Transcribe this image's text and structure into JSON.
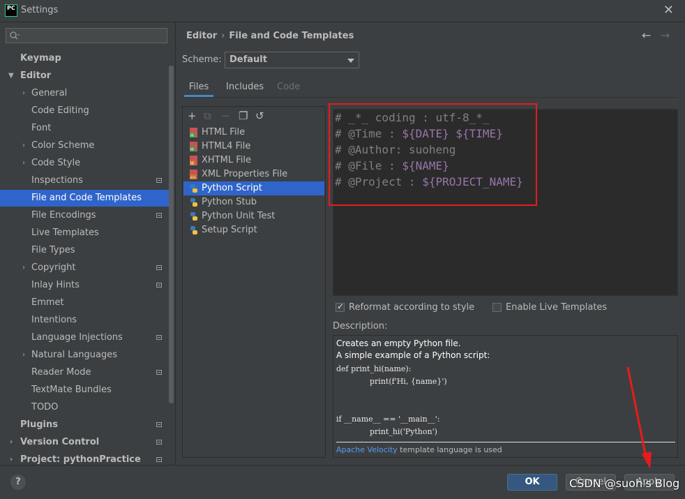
{
  "window": {
    "title": "Settings",
    "app_badge": "PC"
  },
  "sidebar": {
    "search_placeholder": "",
    "items": [
      {
        "label": "Keymap"
      },
      {
        "label": "Editor"
      },
      {
        "label": "General"
      },
      {
        "label": "Code Editing"
      },
      {
        "label": "Font"
      },
      {
        "label": "Color Scheme"
      },
      {
        "label": "Code Style"
      },
      {
        "label": "Inspections"
      },
      {
        "label": "File and Code Templates"
      },
      {
        "label": "File Encodings"
      },
      {
        "label": "Live Templates"
      },
      {
        "label": "File Types"
      },
      {
        "label": "Copyright"
      },
      {
        "label": "Inlay Hints"
      },
      {
        "label": "Emmet"
      },
      {
        "label": "Intentions"
      },
      {
        "label": "Language Injections"
      },
      {
        "label": "Natural Languages"
      },
      {
        "label": "Reader Mode"
      },
      {
        "label": "TextMate Bundles"
      },
      {
        "label": "TODO"
      },
      {
        "label": "Plugins"
      },
      {
        "label": "Version Control"
      },
      {
        "label": "Project: pythonPractice"
      }
    ]
  },
  "breadcrumb": {
    "parent": "Editor",
    "separator": "›",
    "current": "File and Code Templates"
  },
  "scheme": {
    "label": "Scheme:",
    "value": "Default"
  },
  "tabs": [
    {
      "label": "Files"
    },
    {
      "label": "Includes"
    },
    {
      "label": "Code"
    }
  ],
  "templates": [
    {
      "label": "HTML File"
    },
    {
      "label": "HTML4 File"
    },
    {
      "label": "XHTML File"
    },
    {
      "label": "XML Properties File"
    },
    {
      "label": "Python Script"
    },
    {
      "label": "Python Stub"
    },
    {
      "label": "Python Unit Test"
    },
    {
      "label": "Setup Script"
    }
  ],
  "editor": {
    "lines": [
      {
        "prefix": "# _*_ coding : utf-8_*_",
        "var": ""
      },
      {
        "prefix": "# @Time : ",
        "var": "${DATE} ${TIME}"
      },
      {
        "prefix": "# @Author: suoheng",
        "var": ""
      },
      {
        "prefix": "# @File : ",
        "var": "${NAME}"
      },
      {
        "prefix": "# @Project : ",
        "var": "${PROJECT_NAME}"
      }
    ]
  },
  "options": {
    "reformat_label": "Reformat according to style",
    "reformat_checked": true,
    "live_templates_label": "Enable Live Templates",
    "live_templates_checked": false
  },
  "description": {
    "label": "Description:",
    "text_line1": "Creates an empty Python file.",
    "text_line2": "A simple example of a Python script:",
    "code_line1": "def print_hi(name):",
    "code_line2": "print(f'Hi, {name}')",
    "code_line3": "if __name__ == '__main__':",
    "code_line4": "print_hi('Python')",
    "footer_link": "Apache Velocity",
    "footer_text": " template language is used"
  },
  "buttons": {
    "help": "?",
    "ok": "OK",
    "cancel": "Cancel",
    "apply": "Apply"
  },
  "watermark": "CSDN @suoh's Blog",
  "colors": {
    "selection": "#2f65ca",
    "highlight_box": "#e81b1b",
    "template_var": "#9876aa",
    "comment": "#808080"
  }
}
